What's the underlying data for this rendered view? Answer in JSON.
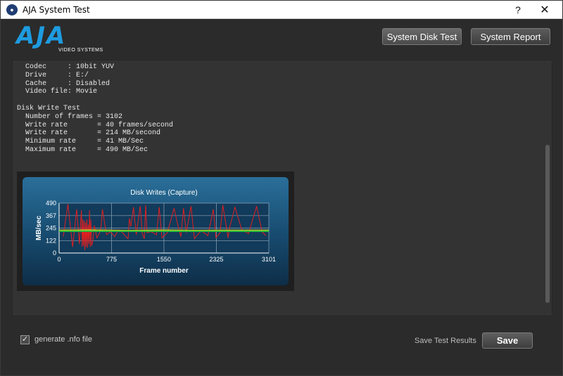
{
  "window": {
    "title": "AJA System Test",
    "help_glyph": "?",
    "close_glyph": "✕"
  },
  "header": {
    "logo_text": "AJA",
    "logo_sub": "VIDEO SYSTEMS",
    "buttons": {
      "disk_test": "System Disk Test",
      "report": "System Report"
    }
  },
  "log": {
    "text": "  Codec     : 10bit YUV\n  Drive     : E:/\n  Cache     : Disabled\n  Video file: Movie\n\nDisk Write Test\n  Number of frames = 3102\n  Write rate       = 40 frames/second\n  Write rate       = 214 MB/second\n  Minimum rate     = 41 MB/Sec\n  Maximum rate     = 490 MB/Sec"
  },
  "chart_data": {
    "type": "line",
    "title": "Disk Writes (Capture)",
    "xlabel": "Frame number",
    "ylabel": "MB/sec",
    "xlim": [
      0,
      3101
    ],
    "ylim": [
      0,
      490
    ],
    "x_ticks": [
      "0",
      "775",
      "1550",
      "2325",
      "3101"
    ],
    "y_ticks": [
      "0",
      "122",
      "245",
      "367",
      "490"
    ],
    "grid": true,
    "series": [
      {
        "color": "#e02020",
        "x": [
          60,
          130,
          200,
          260,
          300,
          330,
          340,
          350,
          360,
          370,
          380,
          390,
          400,
          410,
          420,
          430,
          440,
          450,
          460,
          470,
          480,
          500,
          520,
          560,
          600,
          620,
          640,
          700,
          760,
          820,
          880,
          940,
          1000,
          1020,
          1040,
          1060,
          1100,
          1140,
          1200,
          1230,
          1260,
          1280,
          1300,
          1360,
          1440,
          1480,
          1520,
          1600,
          1700,
          1760,
          1800,
          1840,
          1880,
          1950,
          2000,
          2100,
          2200,
          2280,
          2320,
          2380,
          2420,
          2500,
          2520,
          2600,
          2700,
          2800,
          2920,
          3000,
          3060
        ],
        "values": [
          160,
          480,
          60,
          430,
          90,
          420,
          60,
          330,
          70,
          320,
          30,
          300,
          60,
          330,
          50,
          280,
          90,
          420,
          60,
          330,
          70,
          120,
          270,
          150,
          200,
          260,
          430,
          180,
          210,
          160,
          230,
          200,
          150,
          140,
          340,
          260,
          450,
          180,
          460,
          190,
          140,
          470,
          200,
          210,
          180,
          450,
          150,
          200,
          440,
          260,
          160,
          440,
          200,
          460,
          140,
          220,
          170,
          430,
          150,
          200,
          470,
          150,
          250,
          450,
          230,
          190,
          460,
          210,
          170
        ]
      },
      {
        "color": "#c8c828",
        "x": [
          0,
          500,
          1000,
          1550,
          2000,
          2500,
          3101
        ],
        "values": [
          222,
          225,
          220,
          224,
          221,
          223,
          222
        ]
      },
      {
        "color": "#2fbf3a",
        "x": [
          0,
          500,
          1000,
          1550,
          2000,
          2500,
          3101
        ],
        "values": [
          214,
          214,
          214,
          214,
          214,
          214,
          214
        ]
      }
    ]
  },
  "footer": {
    "checkbox_label": "generate .nfo file",
    "checkbox_glyph": "✓",
    "save_label": "Save Test Results",
    "save_button": "Save"
  }
}
